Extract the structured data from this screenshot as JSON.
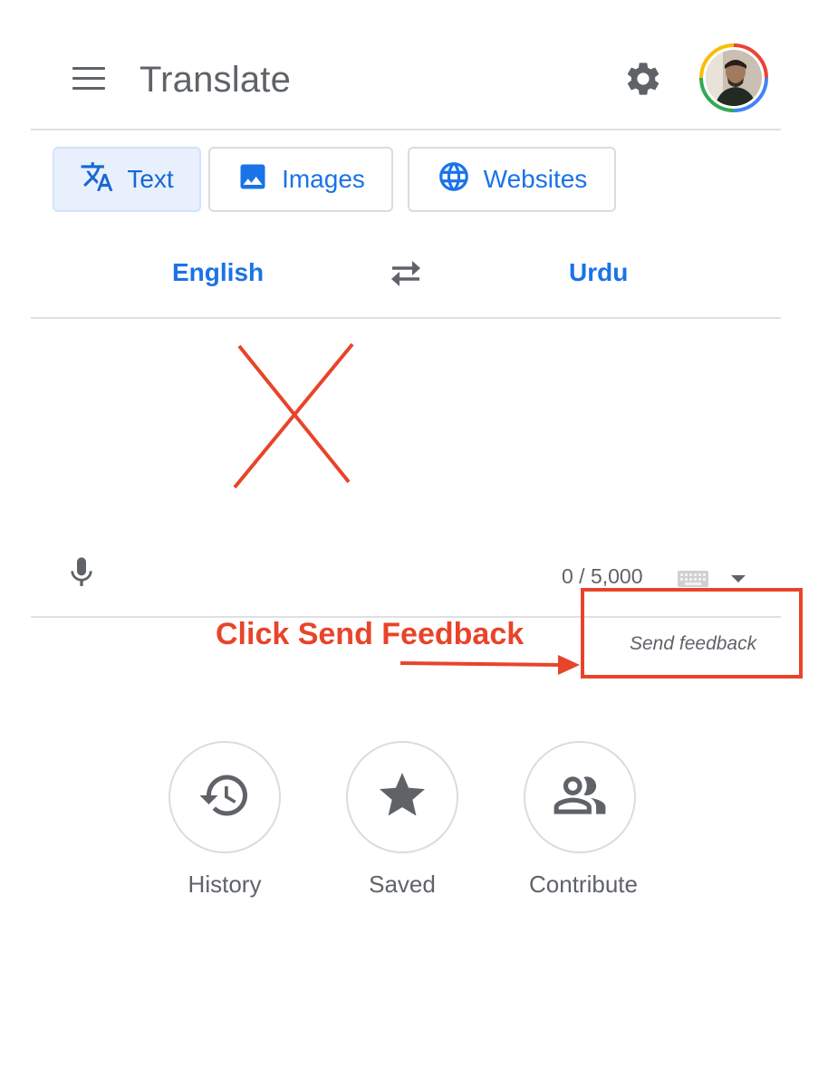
{
  "header": {
    "title": "Translate",
    "menu_icon": "hamburger-menu-icon",
    "settings_icon": "gear-icon",
    "avatar_icon": "user-avatar"
  },
  "tabs": [
    {
      "label": "Text",
      "icon": "translate-icon",
      "active": true
    },
    {
      "label": "Images",
      "icon": "image-icon",
      "active": false
    },
    {
      "label": "Websites",
      "icon": "globe-icon",
      "active": false
    }
  ],
  "languages": {
    "source": "English",
    "target": "Urdu",
    "swap_icon": "swap-arrows-icon"
  },
  "input": {
    "value": "",
    "char_count": "0 / 5,000",
    "mic_icon": "microphone-icon",
    "keyboard_icon": "keyboard-icon",
    "dropdown_icon": "caret-down-icon"
  },
  "annotation": {
    "text": "Click Send Feedback",
    "color": "#e8442a"
  },
  "feedback": {
    "label": "Send feedback"
  },
  "actions": [
    {
      "label": "History",
      "icon": "history-icon"
    },
    {
      "label": "Saved",
      "icon": "star-icon"
    },
    {
      "label": "Contribute",
      "icon": "people-icon"
    }
  ],
  "colors": {
    "accent": "#1a73e8",
    "active_tab_bg": "#e8f0fe",
    "icon_gray": "#5f6368",
    "annotation_red": "#e8442a"
  }
}
